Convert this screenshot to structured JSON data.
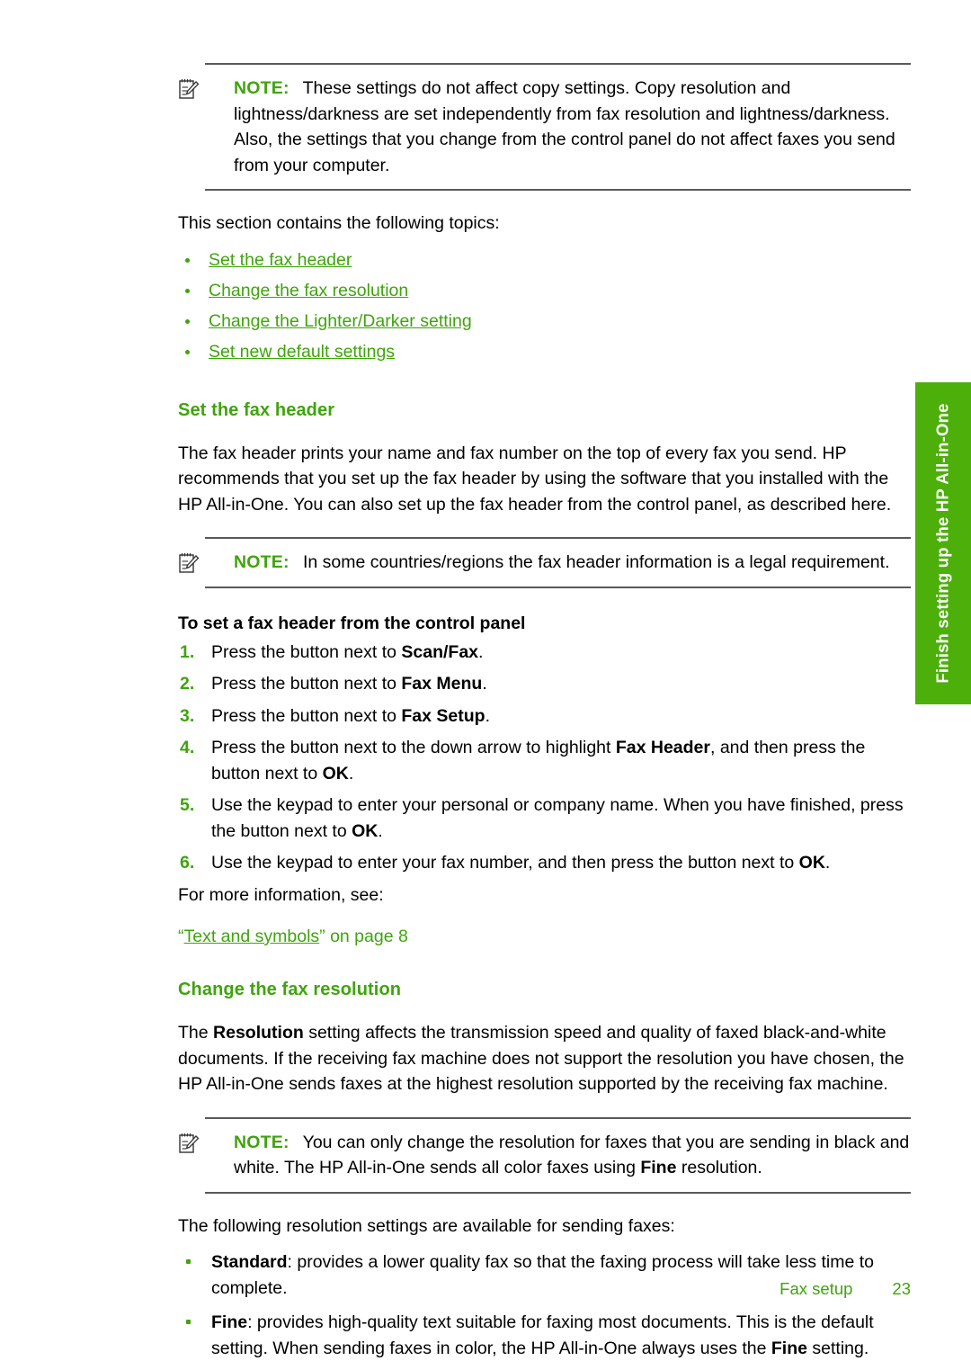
{
  "document": {
    "note_label": "NOTE:",
    "note_icon": "note-pencil-icon"
  },
  "note_top": {
    "label": "NOTE:",
    "text": "These settings do not affect copy settings. Copy resolution and lightness/darkness are set independently from fax resolution and lightness/darkness. Also, the settings that you change from the control panel do not affect faxes you send from your computer."
  },
  "intro": {
    "lead": "This section contains the following topics:",
    "topics": [
      "Set the fax header",
      "Change the fax resolution",
      "Change the Lighter/Darker setting",
      "Set new default settings"
    ]
  },
  "section_fax_header": {
    "heading": "Set the fax header",
    "body": "The fax header prints your name and fax number on the top of every fax you send. HP recommends that you set up the fax header by using the software that you installed with the HP All-in-One. You can also set up the fax header from the control panel, as described here.",
    "note": {
      "label": "NOTE:",
      "text": "In some countries/regions the fax header information is a legal requirement."
    },
    "procedure_heading": "To set a fax header from the control panel",
    "steps": [
      {
        "num": "1.",
        "pre": "Press the button next to ",
        "bold": "Scan/Fax",
        "post": "."
      },
      {
        "num": "2.",
        "pre": "Press the button next to ",
        "bold": "Fax Menu",
        "post": "."
      },
      {
        "num": "3.",
        "pre": "Press the button next to ",
        "bold": "Fax Setup",
        "post": "."
      },
      {
        "num": "4.",
        "pre": "Press the button next to the down arrow to highlight ",
        "bold": "Fax Header",
        "post": ", and then press the button next to ",
        "bold2": "OK",
        "post2": "."
      },
      {
        "num": "5.",
        "pre": "Use the keypad to enter your personal or company name. When you have finished, press the button next to ",
        "bold": "OK",
        "post": "."
      },
      {
        "num": "6.",
        "pre": "Use the keypad to enter your fax number, and then press the button next to ",
        "bold": "OK",
        "post": "."
      }
    ],
    "more_info_lead": "For more information, see:",
    "xref": {
      "open_quote": "“",
      "link": "Text and symbols",
      "close_quote": "”",
      "tail": " on page 8"
    }
  },
  "section_fax_resolution": {
    "heading": "Change the fax resolution",
    "body_pre": "The ",
    "body_bold": "Resolution",
    "body_post": " setting affects the transmission speed and quality of faxed black-and-white documents. If the receiving fax machine does not support the resolution you have chosen, the HP All-in-One sends faxes at the highest resolution supported by the receiving fax machine.",
    "note": {
      "label": "NOTE:",
      "text_pre": "You can only change the resolution for faxes that you are sending in black and white. The HP All-in-One sends all color faxes using ",
      "text_bold": "Fine",
      "text_post": " resolution."
    },
    "list_lead": "The following resolution settings are available for sending faxes:",
    "settings": [
      {
        "name": "Standard",
        "desc": ": provides a lower quality fax so that the faxing process will take less time to complete."
      },
      {
        "name": "Fine",
        "desc_pre": ": provides high-quality text suitable for faxing most documents. This is the default setting. When sending faxes in color, the HP All-in-One always uses the ",
        "desc_bold": "Fine",
        "desc_post": " setting."
      }
    ]
  },
  "side_tab": {
    "label": "Finish setting up the HP All-in-One",
    "color": "#4CAF0A"
  },
  "footer": {
    "section": "Fax setup",
    "page_number": "23",
    "color": "#3fa40c"
  }
}
